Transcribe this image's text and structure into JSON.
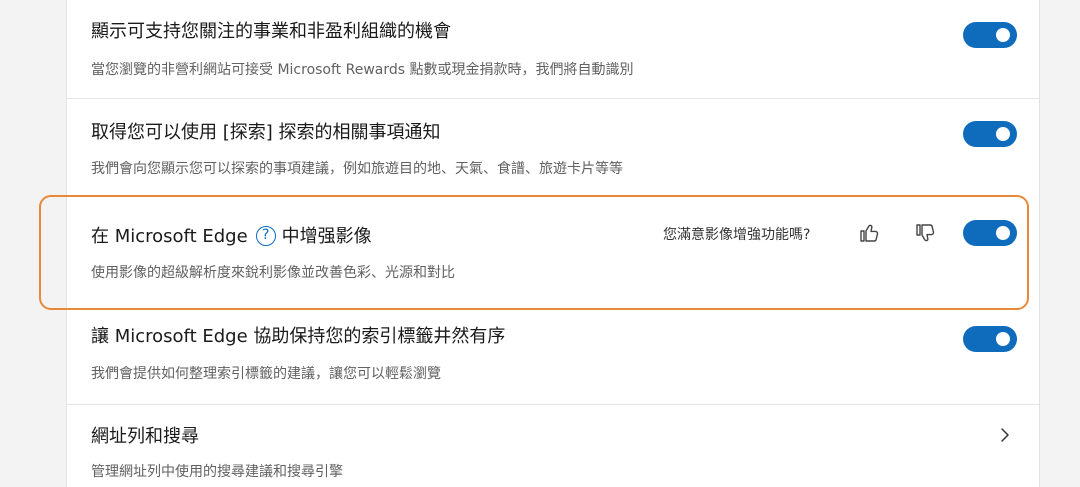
{
  "settings": [
    {
      "title": "顯示可支持您關注的事業和非盈利組織的機會",
      "desc": "當您瀏覽的非營利網站可接受 Microsoft Rewards 點數或現金捐款時，我們將自動識別",
      "toggle": "on"
    },
    {
      "title": "取得您可以使用 [探索] 探索的相關事項通知",
      "desc": "我們會向您顯示您可以探索的事項建議，例如旅遊目的地、天氣、食譜、旅遊卡片等等",
      "toggle": "on"
    },
    {
      "title_before": "在 Microsoft Edge",
      "title_after": "中增强影像",
      "desc": "使用影像的超級解析度來銳利影像並改善色彩、光源和對比",
      "feedback_question": "您滿意影像增強功能嗎?",
      "help_glyph": "?",
      "toggle": "on"
    },
    {
      "title": "讓 Microsoft Edge 協助保持您的索引標籤井然有序",
      "desc": "我們會提供如何整理索引標籤的建議，讓您可以輕鬆瀏覽",
      "toggle": "on"
    },
    {
      "title": "網址列和搜尋",
      "desc": "管理網址列中使用的搜尋建議和搜尋引擎"
    }
  ],
  "colors": {
    "accent": "#0f6cbd",
    "highlight": "#e8893a"
  },
  "icons": [
    "help-icon",
    "thumbs-up-icon",
    "thumbs-down-icon",
    "chevron-right-icon"
  ]
}
